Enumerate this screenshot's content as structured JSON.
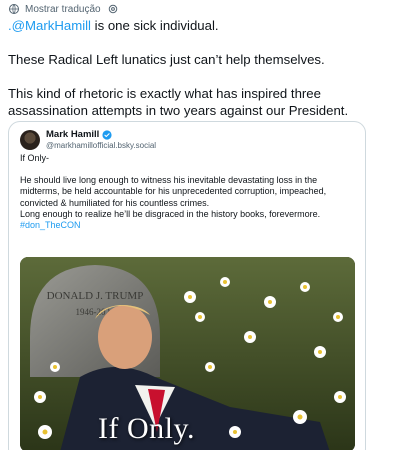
{
  "translate": {
    "label": "Mostrar tradução"
  },
  "post": {
    "mention": ".@MarkHamill",
    "line1_rest": " is one sick individual.",
    "line2": "These Radical Left lunatics just can’t help themselves.",
    "line3": "This kind of rhetoric is exactly what has inspired three assassination attempts in two years against our President."
  },
  "quote": {
    "name": "Mark Hamill",
    "handle": "@markhamillofficial.bsky.social",
    "first_line": "If Only-",
    "paragraph": "He should live long enough to witness his inevitable devastating loss in the midterms, be held accountable for his unprecedented corruption, impeached, convicted & humiliated for his countless crimes.",
    "paragraph2": "Long enough to realize he’ll be disgraced in the history books, forevermore.",
    "hashtag": "#don_TheCON",
    "image": {
      "gravestone_name": "DONALD J. TRUMP",
      "gravestone_dates": "1946-2024",
      "caption": "If Only."
    }
  },
  "colors": {
    "link": "#1d9bf0",
    "secondary": "#536471",
    "border": "#cfd9de"
  },
  "icons": [
    "globe-icon",
    "gear-icon",
    "verified-badge-icon"
  ]
}
